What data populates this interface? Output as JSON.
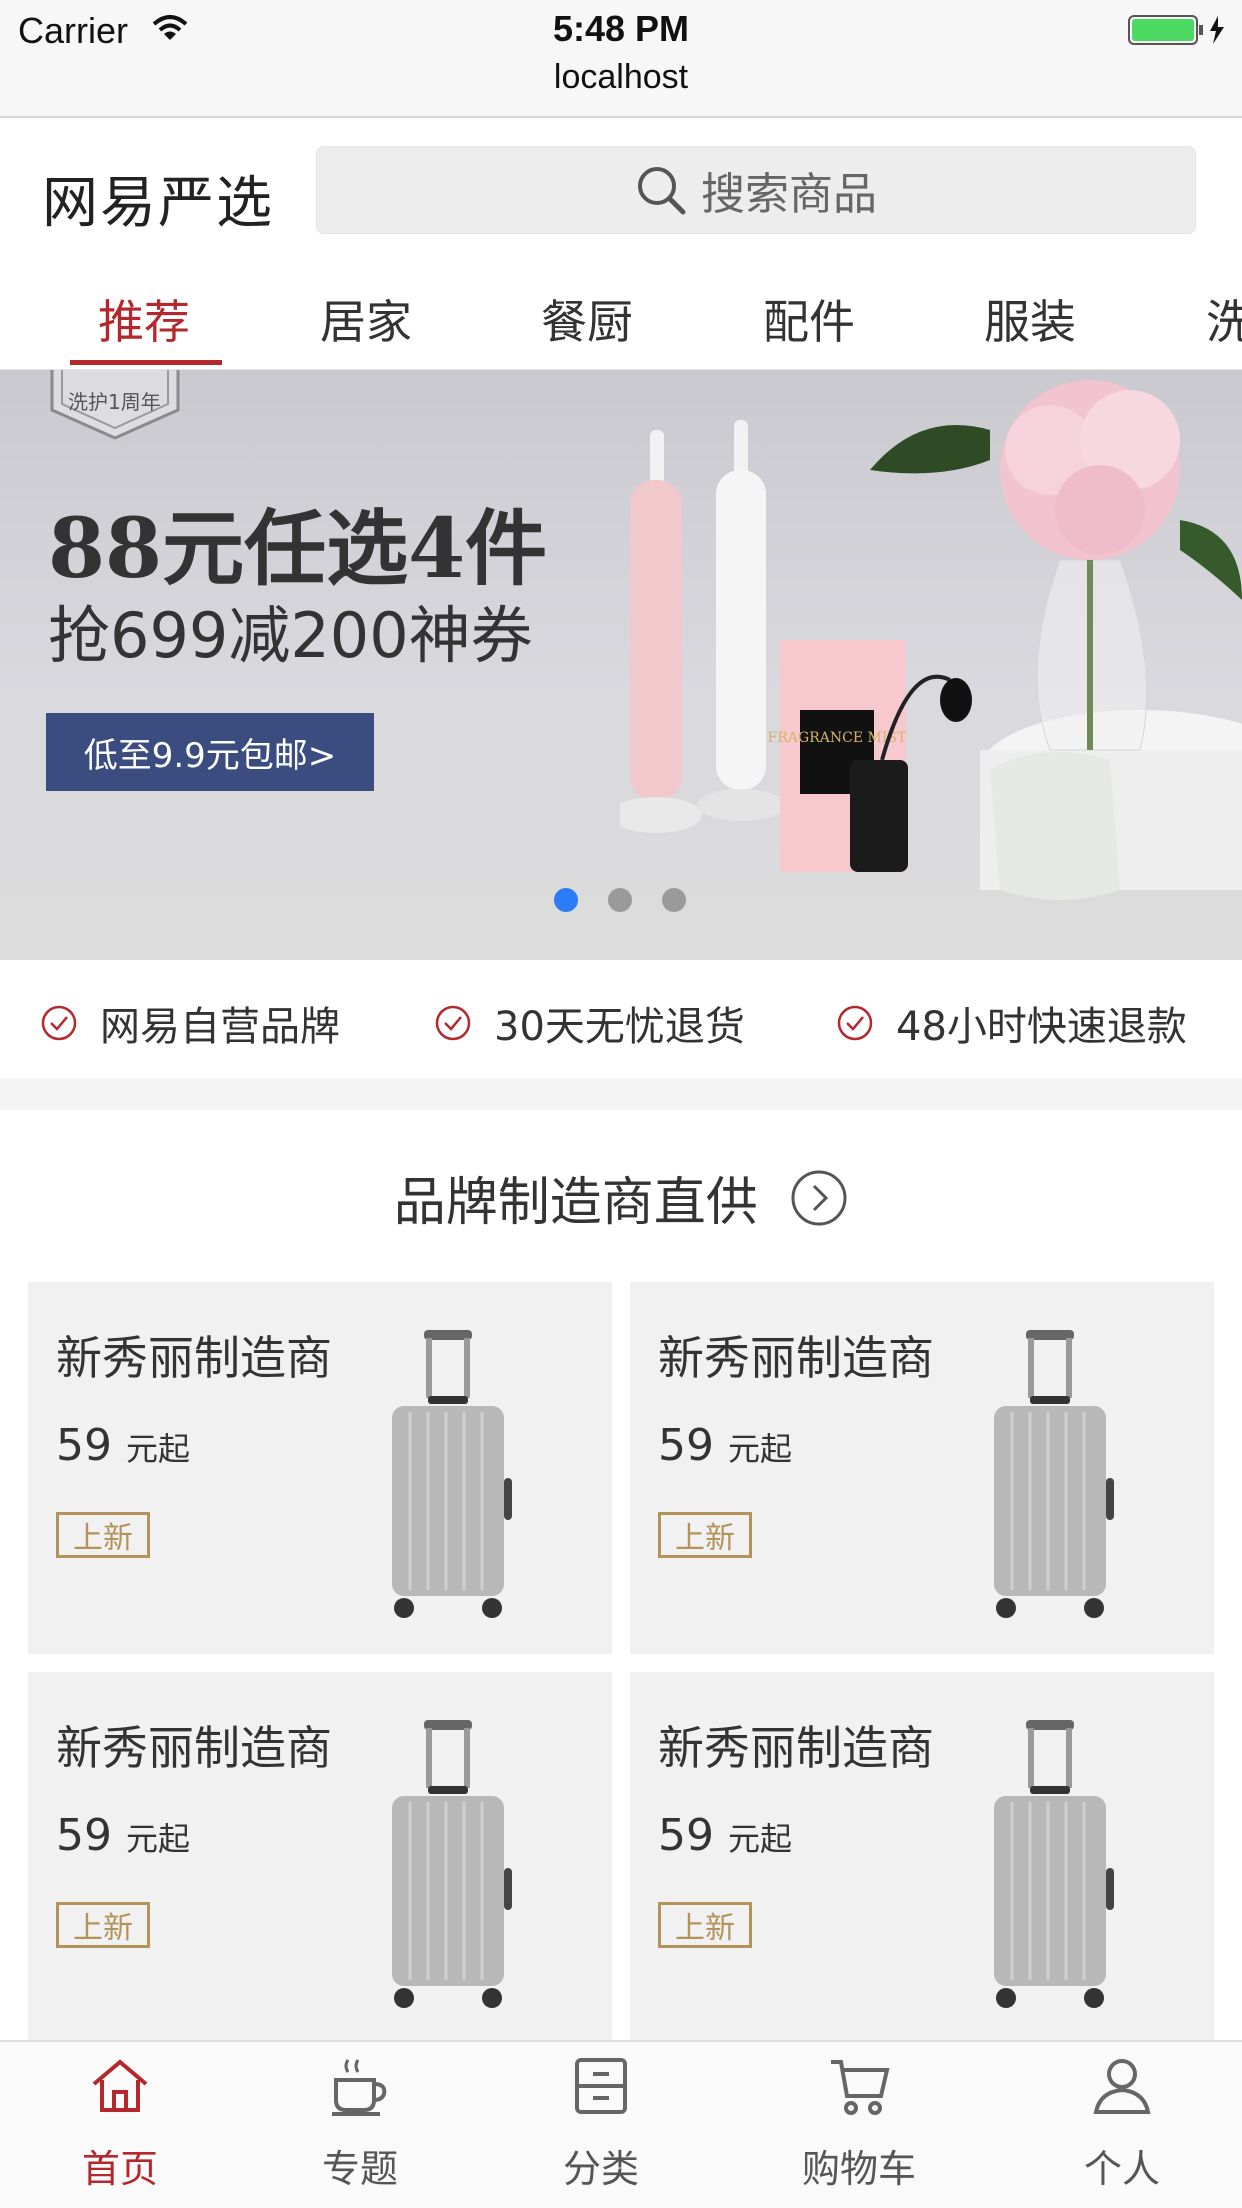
{
  "status_bar": {
    "carrier": "Carrier",
    "time": "5:48 PM",
    "url": "localhost"
  },
  "header": {
    "logo": "网易严选",
    "search_placeholder": "搜索商品"
  },
  "tabs": [
    "推荐",
    "居家",
    "餐厨",
    "配件",
    "服装",
    "洗"
  ],
  "active_tab": 0,
  "banner": {
    "badge": "洗护1周年",
    "title": "88元任选4件",
    "subtitle": "抢699减200神券",
    "button": "低至9.9元包邮>",
    "product_label": "FRAGRANCE MIST",
    "dots_count": 3,
    "active_dot": 0
  },
  "services": [
    "网易自营品牌",
    "30天无忧退货",
    "48小时快速退款"
  ],
  "section": {
    "title": "品牌制造商直供"
  },
  "cards": [
    {
      "name": "新秀丽制造商",
      "price": "59",
      "unit": "元起",
      "tag": "上新"
    },
    {
      "name": "新秀丽制造商",
      "price": "59",
      "unit": "元起",
      "tag": "上新"
    },
    {
      "name": "新秀丽制造商",
      "price": "59",
      "unit": "元起",
      "tag": "上新"
    },
    {
      "name": "新秀丽制造商",
      "price": "59",
      "unit": "元起",
      "tag": "上新"
    }
  ],
  "tabbar": [
    {
      "label": "首页",
      "icon": "home-icon"
    },
    {
      "label": "专题",
      "icon": "coffee-cup-icon"
    },
    {
      "label": "分类",
      "icon": "category-drawer-icon"
    },
    {
      "label": "购物车",
      "icon": "cart-icon"
    },
    {
      "label": "个人",
      "icon": "person-icon"
    }
  ],
  "colors": {
    "accent": "#b4282d",
    "tag": "#b4935a",
    "banner_button": "#3b4d80",
    "active_dot": "#2b7cf6"
  }
}
